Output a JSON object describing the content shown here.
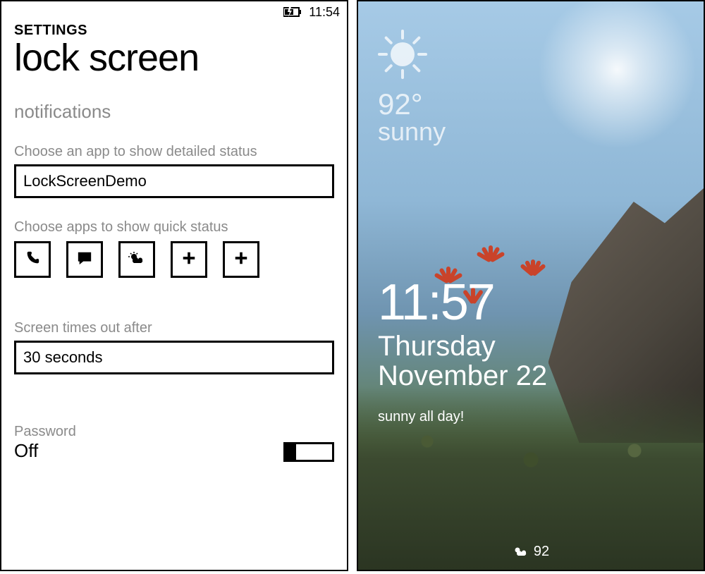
{
  "left": {
    "status": {
      "time": "11:54"
    },
    "header": {
      "breadcrumb": "SETTINGS",
      "title": "lock screen"
    },
    "notifications": {
      "section_label": "notifications",
      "detailed_label": "Choose an app to show detailed status",
      "detailed_app": "LockScreenDemo",
      "quick_label": "Choose apps to show quick status",
      "quick_slots": [
        "phone-icon",
        "message-icon",
        "weather-icon",
        "add-icon",
        "add-icon"
      ]
    },
    "timeout": {
      "label": "Screen times out after",
      "value": "30 seconds"
    },
    "password": {
      "label": "Password",
      "value": "Off"
    }
  },
  "right": {
    "weather": {
      "temp": "92°",
      "condition": "sunny"
    },
    "time": "11:57",
    "date_day": "Thursday",
    "date_line": "November 22",
    "detailed_status": "sunny all day!",
    "quick_status": {
      "icon": "weather-icon",
      "value": "92"
    }
  }
}
